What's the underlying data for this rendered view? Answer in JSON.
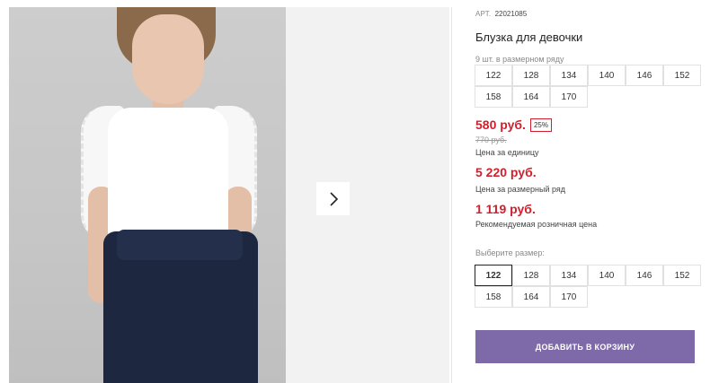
{
  "product": {
    "sku_label": "АРТ.",
    "sku": "22021085",
    "title": "Блузка для девочки",
    "pack_note": "9 шт. в размерном ряду",
    "pack_sizes": [
      "122",
      "128",
      "134",
      "140",
      "146",
      "152",
      "158",
      "164",
      "170"
    ],
    "price": "580 руб.",
    "discount": "25%",
    "old_price": "770 руб.",
    "price_caption": "Цена за единицу",
    "pack_price": "5 220 руб.",
    "pack_price_caption": "Цена за размерный ряд",
    "retail_price": "1 119 руб.",
    "retail_caption": "Рекомендуемая розничная цена",
    "choose_size_label": "Выберите размер:",
    "sizes": [
      "122",
      "128",
      "134",
      "140",
      "146",
      "152",
      "158",
      "164",
      "170"
    ],
    "selected_size": "122",
    "add_to_cart": "ДОБАВИТЬ В КОРЗИНУ"
  },
  "gallery": {
    "next_icon": "chevron-right-icon"
  },
  "colors": {
    "price_red": "#d0202e",
    "button_purple": "#7e6aa9"
  }
}
